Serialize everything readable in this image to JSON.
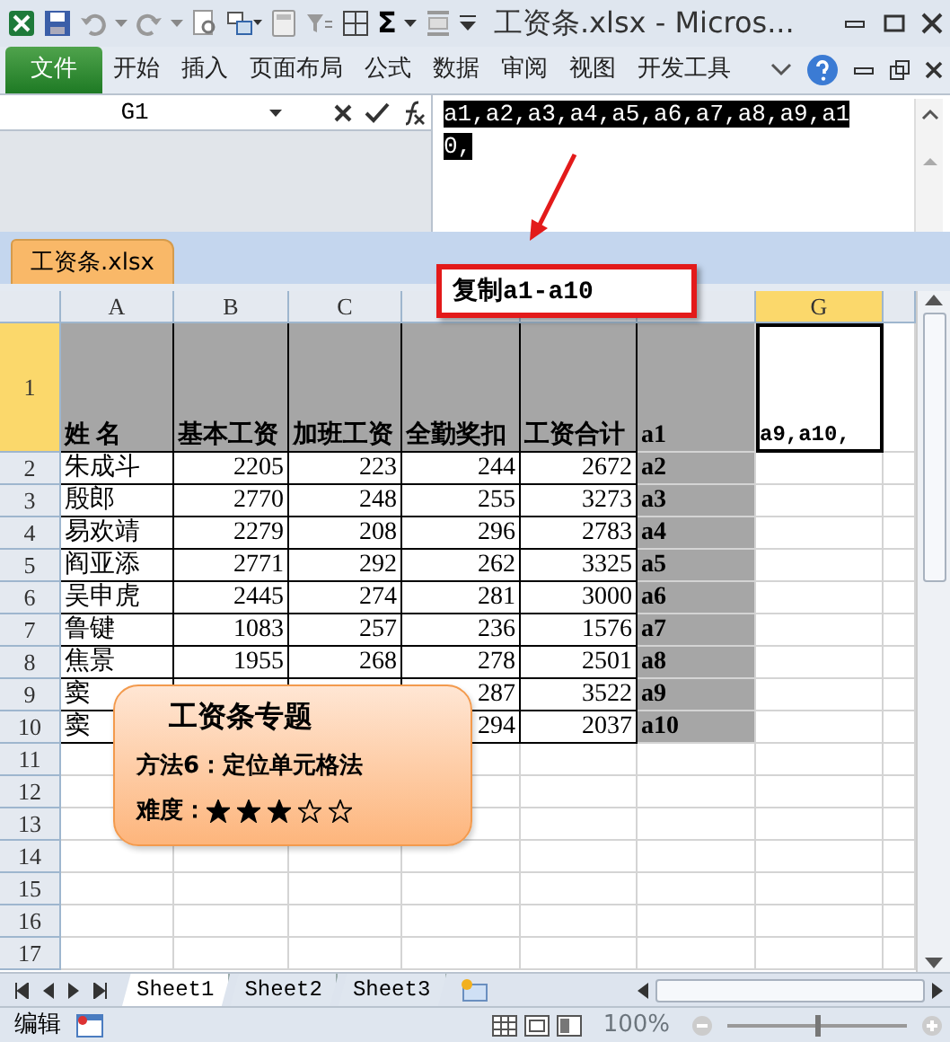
{
  "window": {
    "title": "工资条.xlsx - Micros..."
  },
  "quick_access": {
    "sigma": "Σ"
  },
  "ribbon_tabs": [
    {
      "label": "文件",
      "kind": "file"
    },
    {
      "label": "开始",
      "kind": "tab"
    },
    {
      "label": "插入",
      "kind": "tab"
    },
    {
      "label": "页面布局",
      "kind": "tab"
    },
    {
      "label": "公式",
      "kind": "tab"
    },
    {
      "label": "数据",
      "kind": "tab"
    },
    {
      "label": "审阅",
      "kind": "tab"
    },
    {
      "label": "视图",
      "kind": "tab"
    },
    {
      "label": "开发工具",
      "kind": "tab"
    }
  ],
  "name_box": "G1",
  "formula": "a1,a2,a3,a4,a5,a6,a7,a8,a9,a10,",
  "workbook_tab": "工资条.xlsx",
  "columns": [
    {
      "label": "A",
      "selected": false
    },
    {
      "label": "B",
      "selected": false
    },
    {
      "label": "C",
      "selected": false
    },
    null,
    null,
    null,
    {
      "label": "G",
      "selected": true
    }
  ],
  "rows": [
    {
      "header": "1",
      "selected": true,
      "cells": [
        {
          "text": "姓  名",
          "shaded": true,
          "selected": false
        },
        {
          "text": "基本工资",
          "shaded": true,
          "selected": false
        },
        {
          "text": "加班工资",
          "shaded": true,
          "selected": false
        },
        {
          "text": "全勤奖扣",
          "shaded": true,
          "selected": false
        },
        {
          "text": "工资合计",
          "shaded": true,
          "selected": false
        },
        {
          "text": "a1",
          "shaded": true,
          "selected": false
        },
        {
          "text": "a9,a10,",
          "shaded": false,
          "selected": true
        }
      ]
    },
    {
      "header": "2",
      "selected": false,
      "cells": [
        {
          "text": "朱成斗",
          "shaded": false,
          "selected": false
        },
        {
          "text": "2205",
          "shaded": false,
          "selected": false
        },
        {
          "text": "223",
          "shaded": false,
          "selected": false
        },
        {
          "text": "244",
          "shaded": false,
          "selected": false
        },
        {
          "text": "2672",
          "shaded": false,
          "selected": false
        },
        {
          "text": "a2",
          "shaded": true,
          "selected": false
        }
      ]
    },
    {
      "header": "3",
      "selected": false,
      "cells": [
        {
          "text": "殷郎",
          "shaded": false,
          "selected": false
        },
        {
          "text": "2770",
          "shaded": false,
          "selected": false
        },
        {
          "text": "248",
          "shaded": false,
          "selected": false
        },
        {
          "text": "255",
          "shaded": false,
          "selected": false
        },
        {
          "text": "3273",
          "shaded": false,
          "selected": false
        },
        {
          "text": "a3",
          "shaded": true,
          "selected": false
        }
      ]
    },
    {
      "header": "4",
      "selected": false,
      "cells": [
        {
          "text": "易欢靖",
          "shaded": false,
          "selected": false
        },
        {
          "text": "2279",
          "shaded": false,
          "selected": false
        },
        {
          "text": "208",
          "shaded": false,
          "selected": false
        },
        {
          "text": "296",
          "shaded": false,
          "selected": false
        },
        {
          "text": "2783",
          "shaded": false,
          "selected": false
        },
        {
          "text": "a4",
          "shaded": true,
          "selected": false
        }
      ]
    },
    {
      "header": "5",
      "selected": false,
      "cells": [
        {
          "text": "阎亚添",
          "shaded": false,
          "selected": false
        },
        {
          "text": "2771",
          "shaded": false,
          "selected": false
        },
        {
          "text": "292",
          "shaded": false,
          "selected": false
        },
        {
          "text": "262",
          "shaded": false,
          "selected": false
        },
        {
          "text": "3325",
          "shaded": false,
          "selected": false
        },
        {
          "text": "a5",
          "shaded": true,
          "selected": false
        }
      ]
    },
    {
      "header": "6",
      "selected": false,
      "cells": [
        {
          "text": "吴申虎",
          "shaded": false,
          "selected": false
        },
        {
          "text": "2445",
          "shaded": false,
          "selected": false
        },
        {
          "text": "274",
          "shaded": false,
          "selected": false
        },
        {
          "text": "281",
          "shaded": false,
          "selected": false
        },
        {
          "text": "3000",
          "shaded": false,
          "selected": false
        },
        {
          "text": "a6",
          "shaded": true,
          "selected": false
        }
      ]
    },
    {
      "header": "7",
      "selected": false,
      "cells": [
        {
          "text": "鲁键",
          "shaded": false,
          "selected": false
        },
        {
          "text": "1083",
          "shaded": false,
          "selected": false
        },
        {
          "text": "257",
          "shaded": false,
          "selected": false
        },
        {
          "text": "236",
          "shaded": false,
          "selected": false
        },
        {
          "text": "1576",
          "shaded": false,
          "selected": false
        },
        {
          "text": "a7",
          "shaded": true,
          "selected": false
        }
      ]
    },
    {
      "header": "8",
      "selected": false,
      "cells": [
        {
          "text": "焦景",
          "shaded": false,
          "selected": false
        },
        {
          "text": "1955",
          "shaded": false,
          "selected": false
        },
        {
          "text": "268",
          "shaded": false,
          "selected": false
        },
        {
          "text": "278",
          "shaded": false,
          "selected": false
        },
        {
          "text": "2501",
          "shaded": false,
          "selected": false
        },
        {
          "text": "a8",
          "shaded": true,
          "selected": false
        }
      ]
    },
    {
      "header": "9",
      "selected": false,
      "cells": [
        {
          "text": "窦",
          "shaded": false,
          "selected": false
        },
        null,
        null,
        {
          "text": "287",
          "shaded": false,
          "selected": false
        },
        {
          "text": "3522",
          "shaded": false,
          "selected": false
        },
        {
          "text": "a9",
          "shaded": true,
          "selected": false
        }
      ]
    },
    {
      "header": "10",
      "selected": false,
      "cells": [
        {
          "text": "窦",
          "shaded": false,
          "selected": false
        },
        null,
        null,
        {
          "text": "294",
          "shaded": false,
          "selected": false
        },
        {
          "text": "2037",
          "shaded": false,
          "selected": false
        },
        {
          "text": "a10",
          "shaded": true,
          "selected": false
        }
      ]
    },
    {
      "header": "11",
      "selected": false
    },
    {
      "header": "12",
      "selected": false
    },
    {
      "header": "13",
      "selected": false
    },
    {
      "header": "14",
      "selected": false
    },
    {
      "header": "15",
      "selected": false
    },
    {
      "header": "16",
      "selected": false
    },
    {
      "header": "17",
      "selected": false
    }
  ],
  "copy_callout": "复制a1-a10",
  "info_callout": {
    "title": "工资条专题",
    "method": "方法6：定位单元格法",
    "difficulty_label": "难度：",
    "stars": 3
  },
  "sheet_tabs": [
    {
      "label": "Sheet1",
      "selected": true
    },
    {
      "label": "Sheet2",
      "selected": false
    },
    {
      "label": "Sheet3",
      "selected": false
    }
  ],
  "status": {
    "mode": "编辑",
    "zoom": "100%",
    "zoom_slider": {
      "level": 0.5
    }
  }
}
